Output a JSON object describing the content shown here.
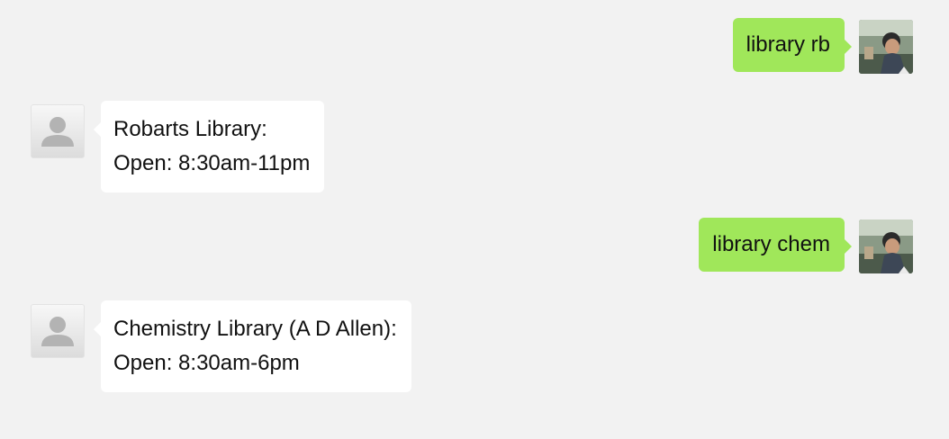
{
  "messages": [
    {
      "from": "user",
      "text": "library rb"
    },
    {
      "from": "bot",
      "lines": [
        "Robarts Library:",
        "Open: 8:30am-11pm"
      ]
    },
    {
      "from": "user",
      "text": "library chem"
    },
    {
      "from": "bot",
      "lines": [
        "Chemistry Library (A D Allen):",
        "Open: 8:30am-6pm"
      ]
    }
  ],
  "colors": {
    "background": "#f2f2f2",
    "outgoing_bubble": "#a0e75a",
    "incoming_bubble": "#ffffff"
  },
  "icons": {
    "bot_avatar": "default-person-avatar-icon",
    "user_avatar": "user-photo-avatar"
  }
}
